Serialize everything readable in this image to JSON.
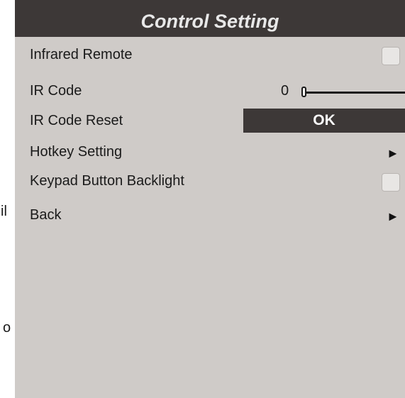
{
  "background_fragments": [
    "il",
    "o"
  ],
  "header": {
    "title": "Control Setting"
  },
  "menu": {
    "infrared_remote": {
      "label": "Infrared Remote",
      "checked": false
    },
    "ir_code": {
      "label": "IR Code",
      "value": "0",
      "level": 0
    },
    "ir_code_reset": {
      "label": "IR Code Reset",
      "button_label": "OK"
    },
    "hotkey_setting": {
      "label": "Hotkey Setting",
      "arrow": "►"
    },
    "keypad_button_backlight": {
      "label": "Keypad Button Backlight",
      "checked": false
    },
    "back": {
      "label": "Back",
      "arrow": "►"
    }
  },
  "colors": {
    "panel_background": "#cfcbc8",
    "header_background": "#3d3837",
    "header_text": "#e8e8e8",
    "ok_button_background": "#3d3837"
  }
}
